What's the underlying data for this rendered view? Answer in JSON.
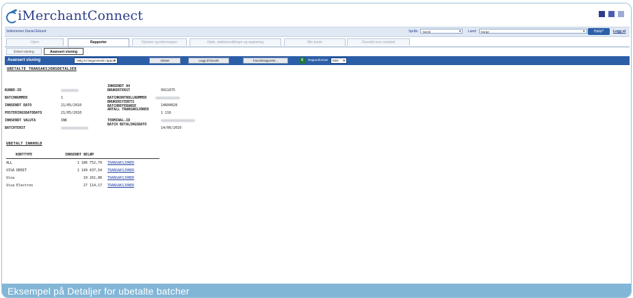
{
  "header": {
    "logo_text": "iMerchantConnect",
    "icons": [
      "square-dark-icon",
      "square-medium-icon",
      "square-light-icon"
    ]
  },
  "welcome_bar": {
    "text": "Velkommen Daniel Eklund",
    "language_label": "Språk:",
    "language_value": "Norsk",
    "country_label": "Land:",
    "country_value": "Norge",
    "help_button": "Hjelp?",
    "logout": "Logg ut"
  },
  "tabs": [
    {
      "label": "Hjem",
      "active": false
    },
    {
      "label": "Rapporter",
      "active": true
    },
    {
      "label": "Nyheter og informasjon",
      "active": false
    },
    {
      "label": "Hjelp, støtteinnstillinger og opplæring",
      "active": false
    },
    {
      "label": "Min konto",
      "active": false
    },
    {
      "label": "Oversikt over nettsted",
      "active": false
    }
  ],
  "subtabs": [
    {
      "label": "Enkel visning",
      "active": false
    },
    {
      "label": "Avansert visning",
      "active": true
    }
  ],
  "toolbar": {
    "title": "Avansert visning",
    "report_select": "Velg en begynnende rapport",
    "buttons": [
      "Aktiver",
      "Legg til favoritt",
      "Favorittrapporter..."
    ],
    "export_icon": "excel-icon",
    "format_label": "Rapportformat",
    "format_value": "html"
  },
  "section1": {
    "title": "UBETALTE TRANSAKSJONSDETALJER",
    "left_rows": [
      {
        "label": "KUNDE-ID",
        "value": ""
      },
      {
        "label": "BATCHNUMMER",
        "value": "1"
      },
      {
        "label": "INNSENDT DATO",
        "value": "21/05/2010"
      },
      {
        "label": "POSTERINGSDATODATO",
        "value": "21/05/2010"
      },
      {
        "label": "INNSENDT VALUTA",
        "value": "INK"
      },
      {
        "label": "BATCHTEKST",
        "value": ""
      }
    ],
    "right_rows": [
      {
        "label": "INNSENDT AV BRUKERTEKST",
        "value": "9911075"
      },
      {
        "label": "BATCHKONTROLLNUMMER",
        "value": ""
      },
      {
        "label": "BRUKERSTEDETS BATCHREFERANSE",
        "value": "14604028"
      },
      {
        "label": "ANTALL TRANSAKSJONER",
        "value": "1 116"
      },
      {
        "label": "TERMINAL-ID",
        "value": ""
      },
      {
        "label": "BATCH BETALINGSDATO",
        "value": "14/06/2010"
      }
    ]
  },
  "section2": {
    "title": "UBETALT INNHOLD",
    "columns": [
      "KORTTYPE",
      "INNSENDT BELØP"
    ],
    "rows": [
      {
        "card": "ALL",
        "amount": "1 186 752,79",
        "link": "TRANSAKSJONER"
      },
      {
        "card": "VISA DEBIT",
        "amount": "1 149 437,54",
        "link": "TRANSAKSJONER"
      },
      {
        "card": "Visa",
        "amount": "19 261,08",
        "link": "TRANSAKSJONER"
      },
      {
        "card": "Visa Electron",
        "amount": "27 114,17",
        "link": "TRANSAKSJONER"
      }
    ]
  },
  "caption": "Eksempel på Detaljer for ubetalte batcher"
}
